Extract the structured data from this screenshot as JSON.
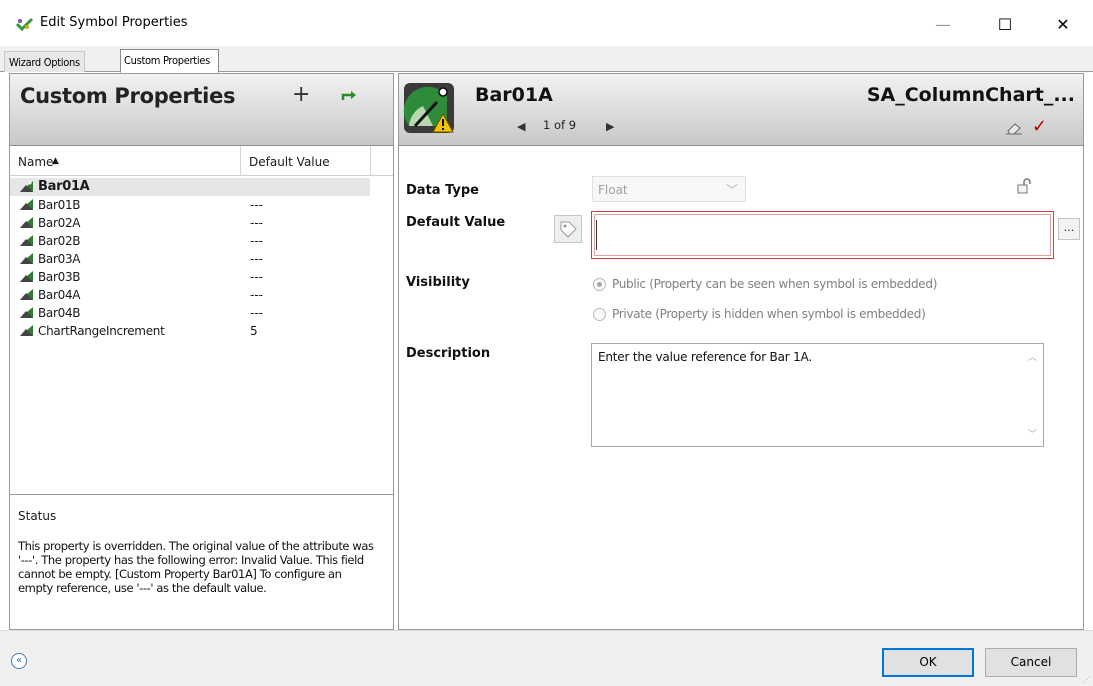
{
  "window": {
    "title": "Edit Symbol Properties",
    "minimize_glyph": "—",
    "maximize_glyph": "☐",
    "close_glyph": "✕"
  },
  "tabs": [
    {
      "label": "Wizard Options",
      "active": false
    },
    {
      "label": "Custom Properties",
      "active": true
    }
  ],
  "left": {
    "heading": "Custom Properties",
    "add_glyph": "+",
    "columns": {
      "name": "Name",
      "default": "Default Value",
      "sort_glyph": "▲"
    },
    "rows": [
      {
        "name": "Bar01A",
        "default": "",
        "selected": true
      },
      {
        "name": "Bar01B",
        "default": "---",
        "selected": false
      },
      {
        "name": "Bar02A",
        "default": "---",
        "selected": false
      },
      {
        "name": "Bar02B",
        "default": "---",
        "selected": false
      },
      {
        "name": "Bar03A",
        "default": "---",
        "selected": false
      },
      {
        "name": "Bar03B",
        "default": "---",
        "selected": false
      },
      {
        "name": "Bar04A",
        "default": "---",
        "selected": false
      },
      {
        "name": "Bar04B",
        "default": "---",
        "selected": false
      },
      {
        "name": "ChartRangeIncrement",
        "default": "5",
        "selected": false
      }
    ],
    "status": {
      "title": "Status",
      "text": "This property is overridden. The original value of the attribute was '---'. The property has the following error: Invalid Value. This field cannot be empty. [Custom Property Bar01A] To configure an empty reference, use '---' as the default value."
    }
  },
  "right": {
    "symbol_name": "Bar01A",
    "nav": {
      "prev_glyph": "◀",
      "count": "1 of 9",
      "next_glyph": "▶"
    },
    "chart_name": "SA_ColumnChart_...",
    "apply_glyph": "✓",
    "labels": {
      "data_type": "Data Type",
      "default_value": "Default Value",
      "visibility": "Visibility",
      "description": "Description"
    },
    "data_type_value": "Float",
    "default_value": "",
    "ellipsis": "...",
    "visibility": {
      "public": "Public (Property can be seen when symbol is embedded)",
      "private": "Private (Property is hidden when symbol is embedded)",
      "selected": "public"
    },
    "description": "Enter the value reference for Bar 1A."
  },
  "footer": {
    "collapse_glyph": "«",
    "ok": "OK",
    "cancel": "Cancel"
  },
  "colors": {
    "error_border": "#d04040",
    "apply_check": "#c00000",
    "ok_focus": "#0078d7"
  }
}
